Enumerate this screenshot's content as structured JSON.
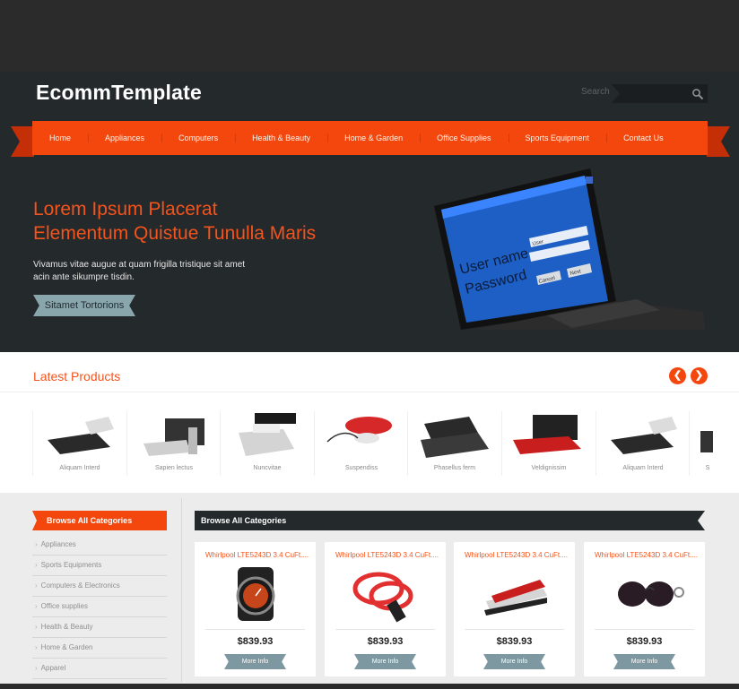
{
  "brand": {
    "logo": "EcommTemplate"
  },
  "search": {
    "label": "Search",
    "placeholder": ""
  },
  "nav": {
    "items": [
      "Home",
      "Appliances",
      "Computers",
      "Health & Beauty",
      "Home & Garden",
      "Office Supplies",
      "Sports Equipment",
      "Contact Us"
    ]
  },
  "hero": {
    "title_line1": "Lorem Ipsum Placerat",
    "title_line2": "Elementum Quistue Tunulla Maris",
    "text_line1": "Vivamus vitae augue at quam frigilla tristique sit amet",
    "text_line2": "acin ante sikumpre tisdin.",
    "button": "Sitamet Tortorions",
    "screen_user": "User name",
    "screen_user_value": "User",
    "screen_password": "Password",
    "screen_cancel": "Cancel",
    "screen_next": "Next"
  },
  "latest": {
    "title": "Latest Products",
    "prev_icon": "chevron-left-icon",
    "next_icon": "chevron-right-icon",
    "items": [
      "Aliquam Interd",
      "Sapien lectus",
      "Nuncvitae",
      "Suspendiss",
      "Phasellus ferm",
      "Veldignissim",
      "Aliquam Interd",
      "S"
    ]
  },
  "sidebar": {
    "heading": "Browse All Categories",
    "items": [
      "Appliances",
      "Sports Equipments",
      "Computers & Electronics",
      "Office supplies",
      "Health & Beauty",
      "Home & Garden",
      "Apparel"
    ]
  },
  "browse": {
    "heading": "Browse All Categories",
    "cards": [
      {
        "title": "Whirlpool LTE5243D 3.4 CuFt....",
        "price": "$839.93",
        "button": "More Info"
      },
      {
        "title": "Whirlpool LTE5243D 3.4 CuFt....",
        "price": "$839.93",
        "button": "More Info"
      },
      {
        "title": "Whirlpool LTE5243D 3.4 CuFt....",
        "price": "$839.93",
        "button": "More Info"
      },
      {
        "title": "Whirlpool LTE5243D 3.4 CuFt....",
        "price": "$839.93",
        "button": "More Info"
      }
    ]
  },
  "colors": {
    "accent": "#f4470d",
    "dark": "#24292c",
    "muted_button": "#8aa6ad"
  }
}
